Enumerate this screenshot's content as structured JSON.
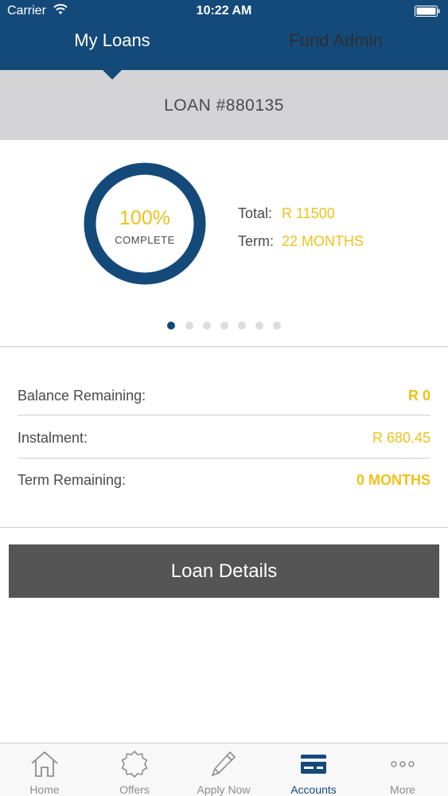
{
  "status_bar": {
    "carrier": "Carrier",
    "time": "10:22 AM"
  },
  "tabs": [
    {
      "label": "My Loans",
      "selected": true
    },
    {
      "label": "Fund Admin",
      "selected": false
    }
  ],
  "loan": {
    "title": "LOAN #880135"
  },
  "progress": {
    "percent_text": "100%",
    "label": "COMPLETE",
    "fraction": 1.0,
    "color": "#144a7a"
  },
  "summary": {
    "total_label": "Total:",
    "total_value": "R 11500",
    "term_label": "Term:",
    "term_value": "22 MONTHS"
  },
  "pager": {
    "count": 7,
    "active_index": 0
  },
  "details": [
    {
      "label": "Balance Remaining:",
      "value": "R 0"
    },
    {
      "label": "Instalment:",
      "value": "R 680.45"
    },
    {
      "label": "Term Remaining:",
      "value": "0 MONTHS"
    }
  ],
  "loan_details_button": "Loan Details",
  "tabbar": [
    {
      "label": "Home",
      "icon": "home-icon"
    },
    {
      "label": "Offers",
      "icon": "offers-badge-icon"
    },
    {
      "label": "Apply Now",
      "icon": "pencil-icon"
    },
    {
      "label": "Accounts",
      "icon": "card-icon",
      "active": true
    },
    {
      "label": "More",
      "icon": "more-dots-icon"
    }
  ],
  "colors": {
    "brand": "#144a7a",
    "accent": "#f0c11a",
    "button": "#555555",
    "banner": "#d4d4d6"
  }
}
